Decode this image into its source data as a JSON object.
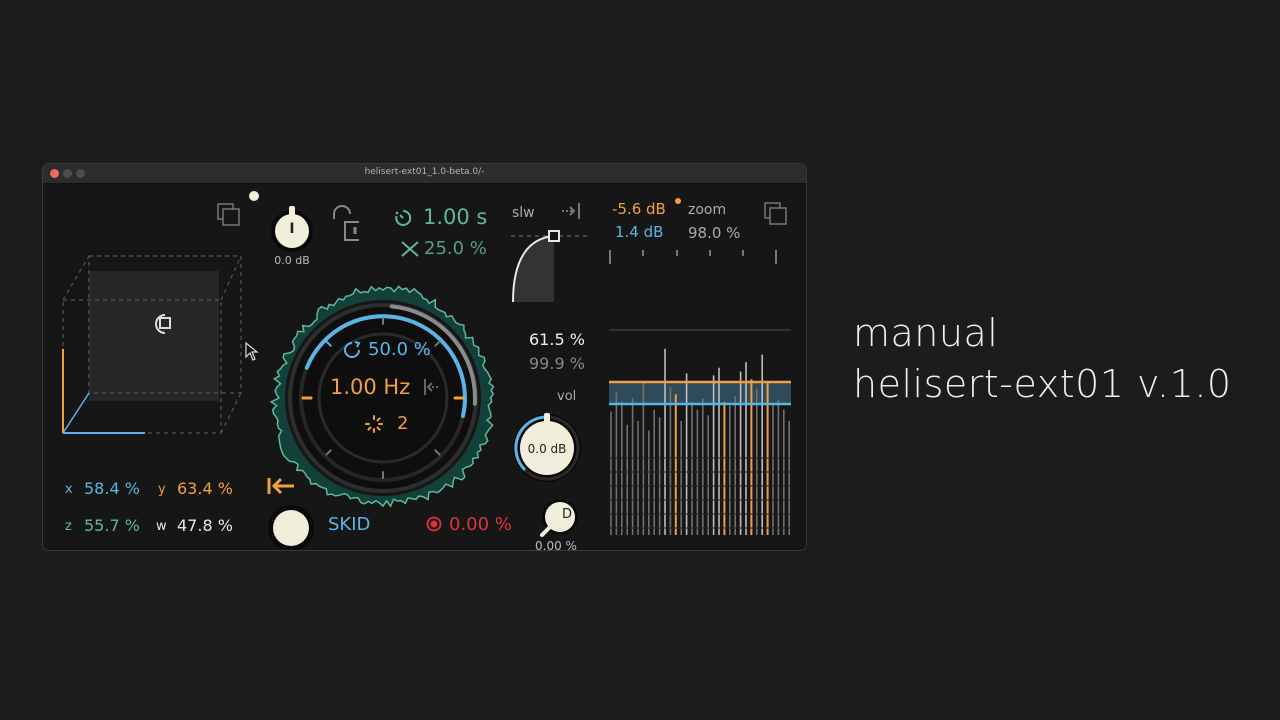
{
  "window": {
    "title": "helisert-ext01_1.0-beta.0/-"
  },
  "side_caption": {
    "line1": "manual",
    "line2": "helisert-ext01 v.1.0"
  },
  "xyz_panel": {
    "x_label": "x",
    "x_value": "58.4 %",
    "y_label": "y",
    "y_value": "63.4 %",
    "z_label": "z",
    "z_value": "55.7 %",
    "w_label": "w",
    "w_value": "47.8 %"
  },
  "input_knob": {
    "glyph": "I",
    "value": "0.0 dB"
  },
  "time_readouts": {
    "time": "1.00 s",
    "mix": "25.0 %"
  },
  "main_dial": {
    "percent": "50.0 %",
    "rate": "1.00 Hz",
    "count": "2",
    "percent_level": 0.5
  },
  "bottom_left": {
    "mode_label": "SKID",
    "record_value": "0.00 %"
  },
  "slw_panel": {
    "label": "slw",
    "value1": "61.5 %",
    "value2": "99.9 %"
  },
  "vol_panel": {
    "label": "vol",
    "value": "0.0 dB",
    "d_glyph": "D",
    "d_value": "0.00 %"
  },
  "meter_panel": {
    "db_orange": "-5.6 dB",
    "db_blue": "1.4 dB",
    "zoom_label": "zoom",
    "zoom_value": "98.0 %"
  },
  "colors": {
    "blue": "#5ab4e6",
    "orange": "#f0a040",
    "green": "#5fb89a",
    "red": "#e0323a",
    "cream": "#f1efdc",
    "gray_text": "#9a9a9a"
  }
}
